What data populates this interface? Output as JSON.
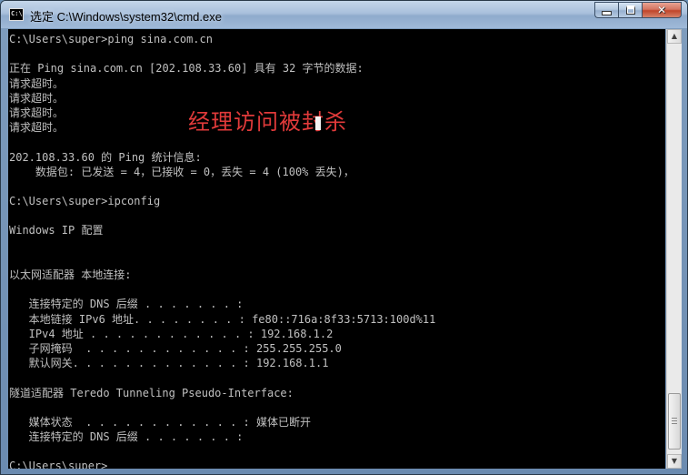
{
  "window": {
    "title": "选定 C:\\Windows\\system32\\cmd.exe",
    "icon": "cmd-console-icon",
    "icon_text": "C:\\",
    "controls": {
      "minimize": "minimize-icon",
      "maximize": "maximize-icon",
      "close": "close-icon",
      "close_glyph": "✕"
    }
  },
  "console": {
    "lines": [
      "C:\\Users\\super>ping sina.com.cn",
      "",
      "正在 Ping sina.com.cn [202.108.33.60] 具有 32 字节的数据:",
      "请求超时。",
      "请求超时。",
      "请求超时。",
      "请求超时。",
      "",
      "202.108.33.60 的 Ping 统计信息:",
      "    数据包: 已发送 = 4，已接收 = 0，丢失 = 4 (100% 丢失)，",
      "",
      "C:\\Users\\super>ipconfig",
      "",
      "Windows IP 配置",
      "",
      "",
      "以太网适配器 本地连接:",
      "",
      "   连接特定的 DNS 后缀 . . . . . . . :",
      "   本地链接 IPv6 地址. . . . . . . . : fe80::716a:8f33:5713:100d%11",
      "   IPv4 地址 . . . . . . . . . . . . : 192.168.1.2",
      "   子网掩码  . . . . . . . . . . . . : 255.255.255.0",
      "   默认网关. . . . . . . . . . . . . : 192.168.1.1",
      "",
      "隧道适配器 Teredo Tunneling Pseudo-Interface:",
      "",
      "   媒体状态  . . . . . . . . . . . . : 媒体已断开",
      "   连接特定的 DNS 后缀 . . . . . . . :",
      "",
      "C:\\Users\\super>"
    ],
    "overlay_annotation": "经理访问被封杀",
    "colors": {
      "background": "#000000",
      "text": "#c0c0c0",
      "annotation": "#e03a3a"
    }
  },
  "scrollbar": {
    "up_arrow": "▲",
    "down_arrow": "▼"
  }
}
